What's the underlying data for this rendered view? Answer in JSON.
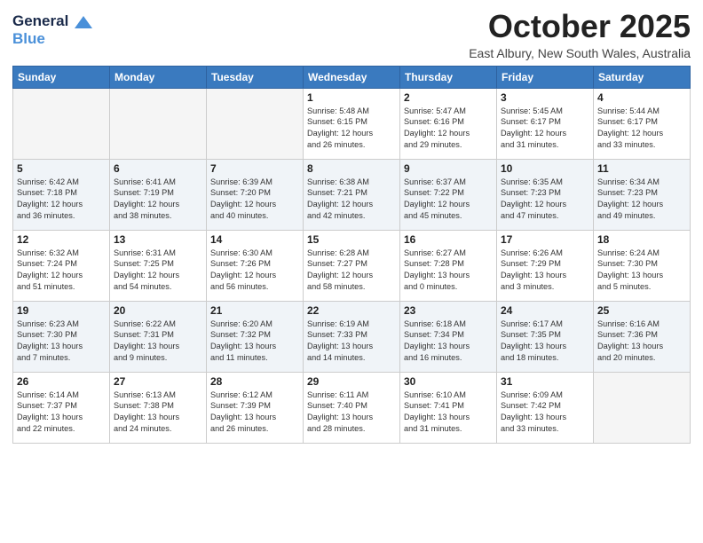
{
  "logo": {
    "line1": "General",
    "line2": "Blue"
  },
  "title": "October 2025",
  "subtitle": "East Albury, New South Wales, Australia",
  "days_header": [
    "Sunday",
    "Monday",
    "Tuesday",
    "Wednesday",
    "Thursday",
    "Friday",
    "Saturday"
  ],
  "weeks": [
    [
      {
        "day": "",
        "info": ""
      },
      {
        "day": "",
        "info": ""
      },
      {
        "day": "",
        "info": ""
      },
      {
        "day": "1",
        "info": "Sunrise: 5:48 AM\nSunset: 6:15 PM\nDaylight: 12 hours\nand 26 minutes."
      },
      {
        "day": "2",
        "info": "Sunrise: 5:47 AM\nSunset: 6:16 PM\nDaylight: 12 hours\nand 29 minutes."
      },
      {
        "day": "3",
        "info": "Sunrise: 5:45 AM\nSunset: 6:17 PM\nDaylight: 12 hours\nand 31 minutes."
      },
      {
        "day": "4",
        "info": "Sunrise: 5:44 AM\nSunset: 6:17 PM\nDaylight: 12 hours\nand 33 minutes."
      }
    ],
    [
      {
        "day": "5",
        "info": "Sunrise: 6:42 AM\nSunset: 7:18 PM\nDaylight: 12 hours\nand 36 minutes."
      },
      {
        "day": "6",
        "info": "Sunrise: 6:41 AM\nSunset: 7:19 PM\nDaylight: 12 hours\nand 38 minutes."
      },
      {
        "day": "7",
        "info": "Sunrise: 6:39 AM\nSunset: 7:20 PM\nDaylight: 12 hours\nand 40 minutes."
      },
      {
        "day": "8",
        "info": "Sunrise: 6:38 AM\nSunset: 7:21 PM\nDaylight: 12 hours\nand 42 minutes."
      },
      {
        "day": "9",
        "info": "Sunrise: 6:37 AM\nSunset: 7:22 PM\nDaylight: 12 hours\nand 45 minutes."
      },
      {
        "day": "10",
        "info": "Sunrise: 6:35 AM\nSunset: 7:23 PM\nDaylight: 12 hours\nand 47 minutes."
      },
      {
        "day": "11",
        "info": "Sunrise: 6:34 AM\nSunset: 7:23 PM\nDaylight: 12 hours\nand 49 minutes."
      }
    ],
    [
      {
        "day": "12",
        "info": "Sunrise: 6:32 AM\nSunset: 7:24 PM\nDaylight: 12 hours\nand 51 minutes."
      },
      {
        "day": "13",
        "info": "Sunrise: 6:31 AM\nSunset: 7:25 PM\nDaylight: 12 hours\nand 54 minutes."
      },
      {
        "day": "14",
        "info": "Sunrise: 6:30 AM\nSunset: 7:26 PM\nDaylight: 12 hours\nand 56 minutes."
      },
      {
        "day": "15",
        "info": "Sunrise: 6:28 AM\nSunset: 7:27 PM\nDaylight: 12 hours\nand 58 minutes."
      },
      {
        "day": "16",
        "info": "Sunrise: 6:27 AM\nSunset: 7:28 PM\nDaylight: 13 hours\nand 0 minutes."
      },
      {
        "day": "17",
        "info": "Sunrise: 6:26 AM\nSunset: 7:29 PM\nDaylight: 13 hours\nand 3 minutes."
      },
      {
        "day": "18",
        "info": "Sunrise: 6:24 AM\nSunset: 7:30 PM\nDaylight: 13 hours\nand 5 minutes."
      }
    ],
    [
      {
        "day": "19",
        "info": "Sunrise: 6:23 AM\nSunset: 7:30 PM\nDaylight: 13 hours\nand 7 minutes."
      },
      {
        "day": "20",
        "info": "Sunrise: 6:22 AM\nSunset: 7:31 PM\nDaylight: 13 hours\nand 9 minutes."
      },
      {
        "day": "21",
        "info": "Sunrise: 6:20 AM\nSunset: 7:32 PM\nDaylight: 13 hours\nand 11 minutes."
      },
      {
        "day": "22",
        "info": "Sunrise: 6:19 AM\nSunset: 7:33 PM\nDaylight: 13 hours\nand 14 minutes."
      },
      {
        "day": "23",
        "info": "Sunrise: 6:18 AM\nSunset: 7:34 PM\nDaylight: 13 hours\nand 16 minutes."
      },
      {
        "day": "24",
        "info": "Sunrise: 6:17 AM\nSunset: 7:35 PM\nDaylight: 13 hours\nand 18 minutes."
      },
      {
        "day": "25",
        "info": "Sunrise: 6:16 AM\nSunset: 7:36 PM\nDaylight: 13 hours\nand 20 minutes."
      }
    ],
    [
      {
        "day": "26",
        "info": "Sunrise: 6:14 AM\nSunset: 7:37 PM\nDaylight: 13 hours\nand 22 minutes."
      },
      {
        "day": "27",
        "info": "Sunrise: 6:13 AM\nSunset: 7:38 PM\nDaylight: 13 hours\nand 24 minutes."
      },
      {
        "day": "28",
        "info": "Sunrise: 6:12 AM\nSunset: 7:39 PM\nDaylight: 13 hours\nand 26 minutes."
      },
      {
        "day": "29",
        "info": "Sunrise: 6:11 AM\nSunset: 7:40 PM\nDaylight: 13 hours\nand 28 minutes."
      },
      {
        "day": "30",
        "info": "Sunrise: 6:10 AM\nSunset: 7:41 PM\nDaylight: 13 hours\nand 31 minutes."
      },
      {
        "day": "31",
        "info": "Sunrise: 6:09 AM\nSunset: 7:42 PM\nDaylight: 13 hours\nand 33 minutes."
      },
      {
        "day": "",
        "info": ""
      }
    ]
  ]
}
